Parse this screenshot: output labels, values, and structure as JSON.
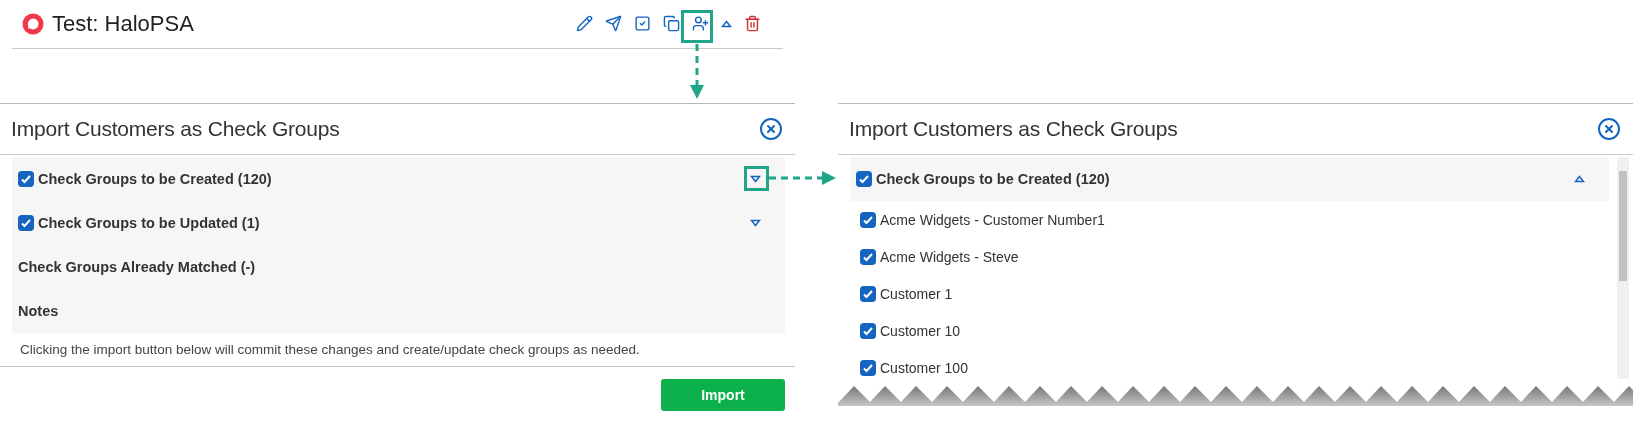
{
  "header": {
    "title": "Test: HaloPSA"
  },
  "dialogs": [
    {
      "title": "Import Customers as Check Groups",
      "sections": [
        {
          "kind": "checkbox",
          "label": "Check Groups to be Created (120)",
          "checked": true,
          "expanded": false
        },
        {
          "kind": "checkbox",
          "label": "Check Groups to be Updated (1)",
          "checked": true,
          "expanded": false
        },
        {
          "kind": "plain",
          "label": "Check Groups Already Matched (-)"
        },
        {
          "kind": "plain",
          "label": "Notes"
        }
      ],
      "note": "Clicking the import button below will commit these changes and create/update check groups as needed.",
      "button": "Import"
    },
    {
      "title": "Import Customers as Check Groups",
      "sections": [
        {
          "kind": "checkbox",
          "label": "Check Groups to be Created (120)",
          "checked": true,
          "expanded": true,
          "items": [
            {
              "label": "Acme Widgets - Customer Number1",
              "checked": true
            },
            {
              "label": "Acme Widgets - Steve",
              "checked": true
            },
            {
              "label": "Customer 1",
              "checked": true
            },
            {
              "label": "Customer 10",
              "checked": true
            },
            {
              "label": "Customer 100",
              "checked": true
            }
          ]
        }
      ]
    }
  ]
}
